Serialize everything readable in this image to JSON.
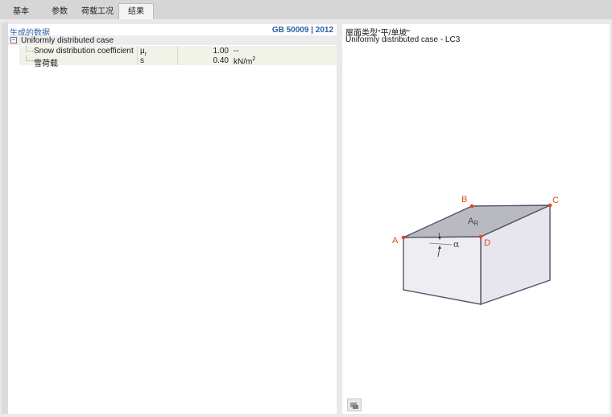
{
  "tabs": [
    {
      "label": "基本",
      "active": false
    },
    {
      "label": "参数",
      "active": false
    },
    {
      "label": "荷载工况",
      "active": false
    },
    {
      "label": "结果",
      "active": true
    }
  ],
  "left_panel": {
    "title": "生成的数据",
    "standard": "GB 50009 | 2012",
    "group": {
      "label": "Uniformly distributed case",
      "rows": [
        {
          "name": "Snow distribution coefficient",
          "symbol": "μr",
          "value": "1.00",
          "unit": "--"
        },
        {
          "name": "雪荷载",
          "symbol": "s",
          "value": "0.40",
          "unit": "kN/m²"
        }
      ]
    }
  },
  "right_panel": {
    "title": "屋面类型\"平/单坡\"",
    "subtitle": "Uniformly distributed case - LC3",
    "diagram": {
      "points": [
        "A",
        "B",
        "C",
        "D"
      ],
      "area_label": "AR",
      "angle_label": "α"
    }
  },
  "colors": {
    "accent_blue": "#2b5fa5",
    "point_orange": "#e04b1a",
    "roof_fill": "#b9b9c2",
    "wall_fill": "#eeeef2",
    "edge": "#55556a"
  },
  "icons": {
    "right_panel_button": "print-icon"
  }
}
